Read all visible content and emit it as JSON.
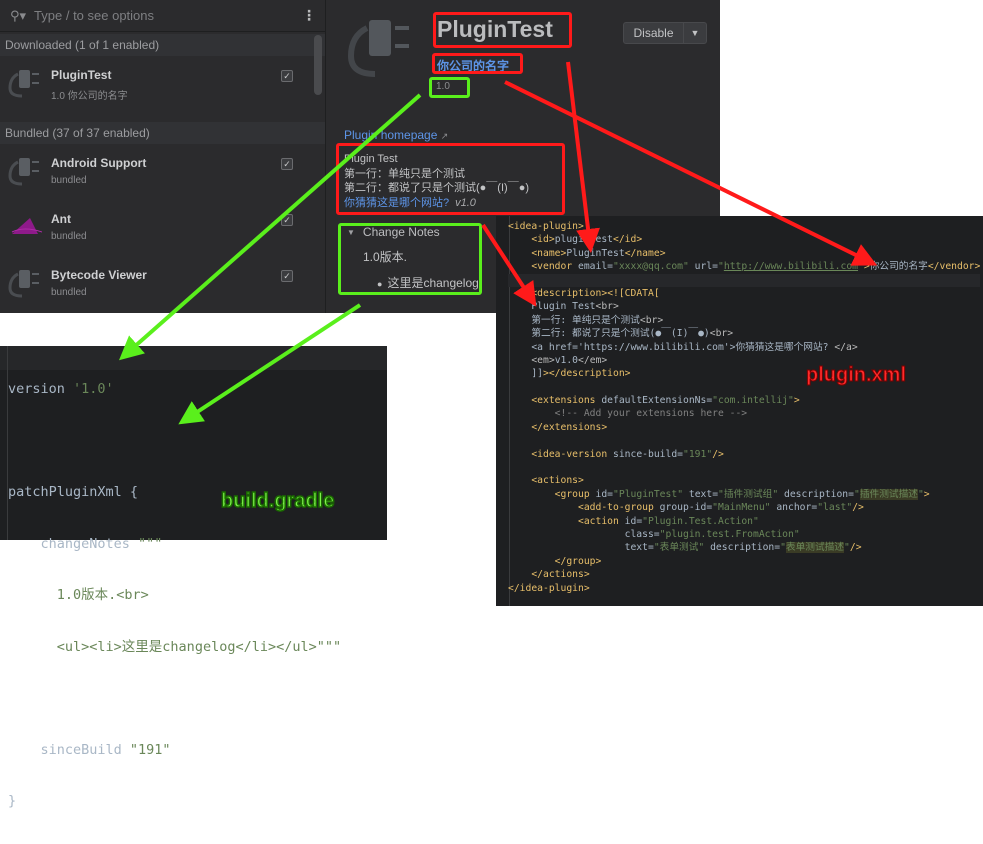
{
  "plugins_list": {
    "search_placeholder": "Type / to see options",
    "menu_icon": "more-vertical-icon",
    "sections": [
      {
        "header": "Downloaded (1 of 1 enabled)"
      },
      {
        "header": "Bundled (37 of 37 enabled)"
      }
    ],
    "items": [
      {
        "name": "PluginTest",
        "sub": "1.0  你公司的名字",
        "checked": true,
        "icon": "plug-icon"
      },
      {
        "name": "Android Support",
        "sub": "bundled",
        "checked": true,
        "icon": "plug-icon"
      },
      {
        "name": "Ant",
        "sub": "bundled",
        "checked": true,
        "icon": "ant-logo-icon"
      },
      {
        "name": "Bytecode Viewer",
        "sub": "bundled",
        "checked": true,
        "icon": "plug-icon"
      }
    ]
  },
  "detail": {
    "title": "PluginTest",
    "vendor": "你公司的名字",
    "version": "1.0",
    "disable_label": "Disable",
    "homepage_label": "Plugin homepage",
    "homepage_icon": "↗",
    "description": {
      "line1": "Plugin Test",
      "line2": "第一行：单纯只是个测试",
      "line3": "第二行：都说了只是个测试(●￣(I)￣●)",
      "link": "你猜猜这是哪个网站?",
      "em": "v1.0"
    },
    "change_notes": {
      "header": "Change Notes",
      "line1": "1.0版本.",
      "bullet": "这里是changelog"
    }
  },
  "gradle": {
    "label": "build.gradle",
    "lines": [
      {
        "k": "version ",
        "s": "'1.0'"
      },
      {
        "k": "",
        "s": ""
      },
      {
        "k": "patchPluginXml {",
        "s": ""
      },
      {
        "k": "    changeNotes ",
        "s": "\"\"\""
      },
      {
        "k": "      ",
        "s": "1.0版本.<br>"
      },
      {
        "k": "      ",
        "s": "<ul><li>这里是changelog</li></ul>\"\"\""
      },
      {
        "k": "",
        "s": ""
      },
      {
        "k": "    sinceBuild ",
        "s": "\"191\""
      },
      {
        "k": "}",
        "s": ""
      }
    ]
  },
  "xml": {
    "label": "plugin.xml",
    "lines": [
      "<idea-plugin>",
      "    <id>plugintest</id>",
      "    <name>PluginTest</name>",
      "    <vendor email=\"xxxx@qq.com\" url=\"http://www.bilibili.com\">你公司的名字</vendor>",
      "",
      "    <description><![CDATA[",
      "    Plugin Test<br>",
      "    第一行: 单纯只是个测试<br>",
      "    第二行: 都说了只是个测试(●￣(I)￣●)<br>",
      "    <a href='https://www.bilibili.com'>你猜猜这是哪个网站? </a>",
      "    <em>v1.0</em>",
      "    ]]></description>",
      "",
      "    <extensions defaultExtensionNs=\"com.intellij\">",
      "        <!-- Add your extensions here -->",
      "    </extensions>",
      "",
      "    <idea-version since-build=\"191\"/>",
      "",
      "    <actions>",
      "        <group id=\"PluginTest\" text=\"插件测试组\" description=\"插件测试描述\">",
      "            <add-to-group group-id=\"MainMenu\" anchor=\"last\"/>",
      "            <action id=\"Plugin.Test.Action\"",
      "                    class=\"plugin.test.FromAction\"",
      "                    text=\"表单测试\" description=\"表单测试描述\"/>",
      "        </group>",
      "    </actions>",
      "</idea-plugin>"
    ]
  },
  "annotation_colors": {
    "red": "#ff1a1a",
    "green": "#5aef1c"
  }
}
